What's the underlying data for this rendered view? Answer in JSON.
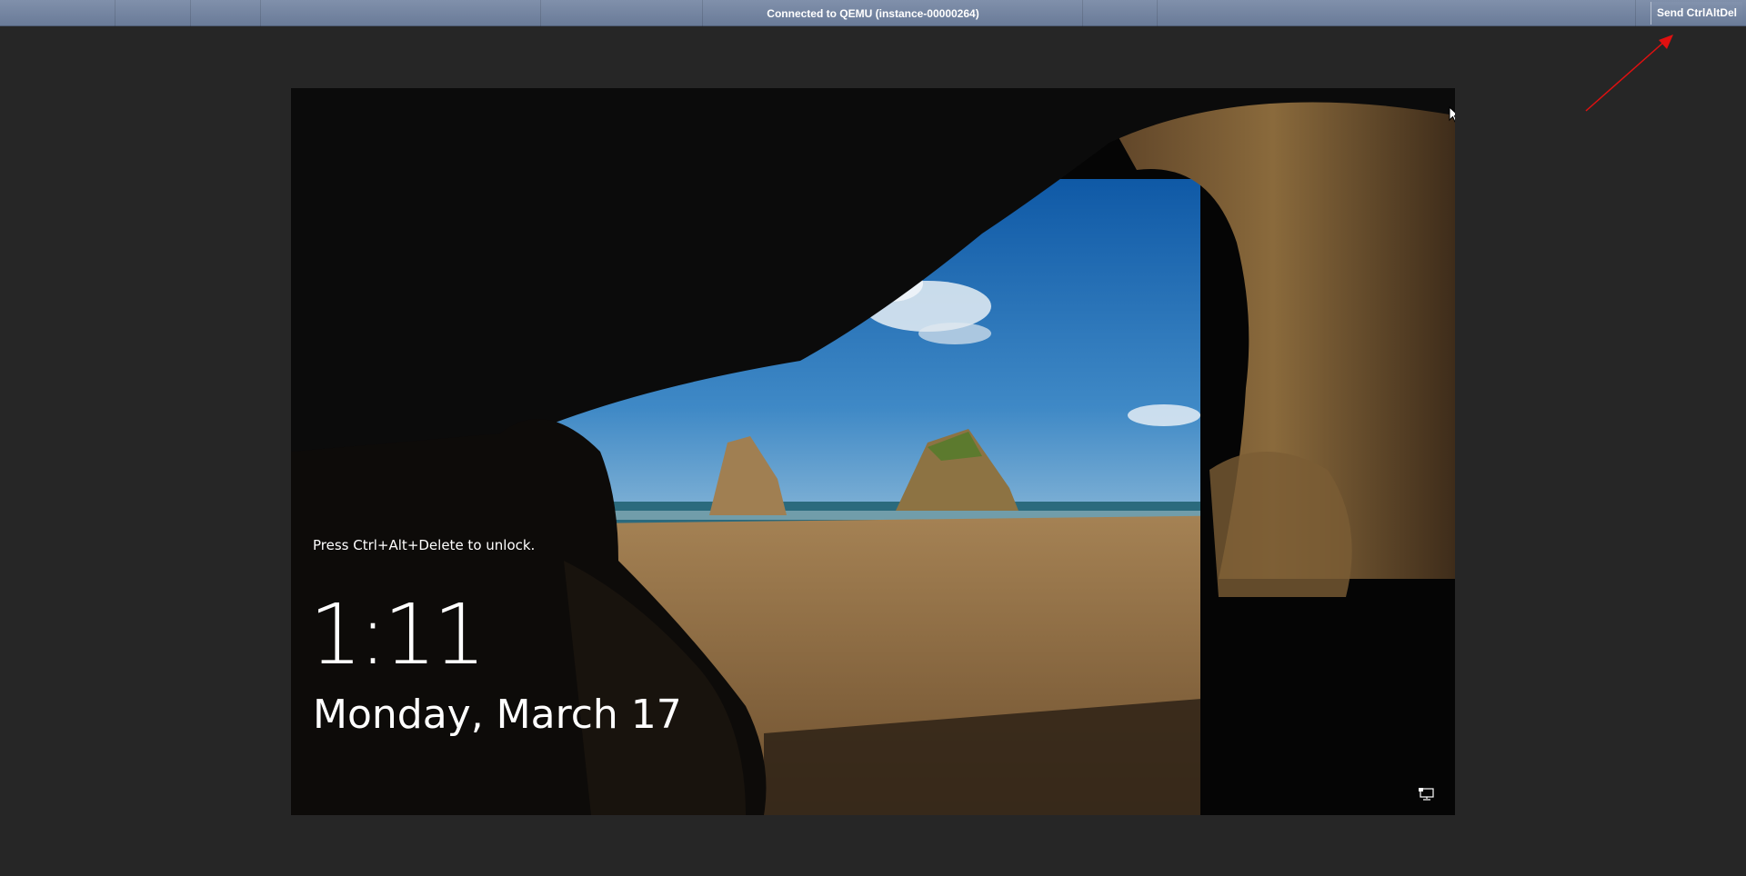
{
  "topbar": {
    "status_text": "Connected to QEMU (instance-00000264)",
    "send_button_label": "Send CtrlAltDel"
  },
  "lockscreen": {
    "hint": "Press Ctrl+Alt+Delete to unlock.",
    "time": "1:11",
    "date": "Monday, March 17",
    "network_icon": "network-status-icon"
  },
  "colors": {
    "topbar": "#7586a2",
    "page_background": "#262626",
    "annotation_arrow": "#e01010"
  }
}
